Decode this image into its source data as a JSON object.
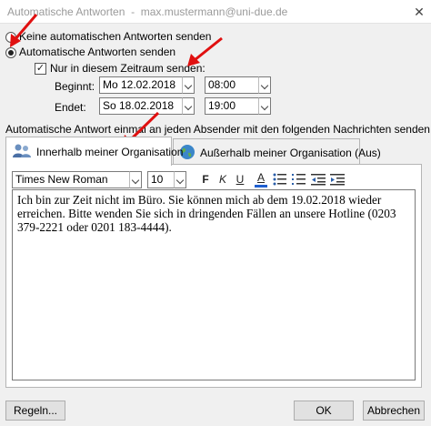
{
  "window": {
    "title": "Automatische Antworten",
    "account": "max.mustermann@uni-due.de",
    "close_glyph": "✕"
  },
  "options": {
    "no_replies_label": "Keine automatischen Antworten senden",
    "send_replies_label": "Automatische Antworten senden",
    "selected": "send_replies",
    "time_range_label": "Nur in diesem Zeitraum senden:",
    "time_range_checked": true
  },
  "schedule": {
    "start_label": "Beginnt:",
    "start_date": "Mo 12.02.2018",
    "start_time": "08:00",
    "end_label": "Endet:",
    "end_date": "So 18.02.2018",
    "end_time": "19:00"
  },
  "instruction": "Automatische Antwort einmal an jeden Absender mit den folgenden Nachrichten senden:",
  "tabs": [
    {
      "label": "Innerhalb meiner Organisation",
      "icon": "people-icon",
      "active": true
    },
    {
      "label": "Außerhalb meiner Organisation (Aus)",
      "icon": "globe-icon",
      "active": false
    }
  ],
  "toolbar": {
    "font_name": "Times New Roman",
    "font_size": "10",
    "bold": "F",
    "italic": "K",
    "underline": "U",
    "font_color": "A",
    "font_color_hex": "#1f5fd0"
  },
  "message": "Ich bin zur Zeit nicht im Büro. Sie können mich ab dem 19.02.2018 wieder erreichen. Bitte wenden Sie sich in dringenden Fällen an unsere Hotline (0203 379-2221 oder 0201 183-4444).",
  "buttons": {
    "rules": "Regeln...",
    "ok": "OK",
    "cancel": "Abbrechen"
  },
  "colors": {
    "annotation_arrow": "#e01010",
    "background": "#f0f0f0"
  }
}
